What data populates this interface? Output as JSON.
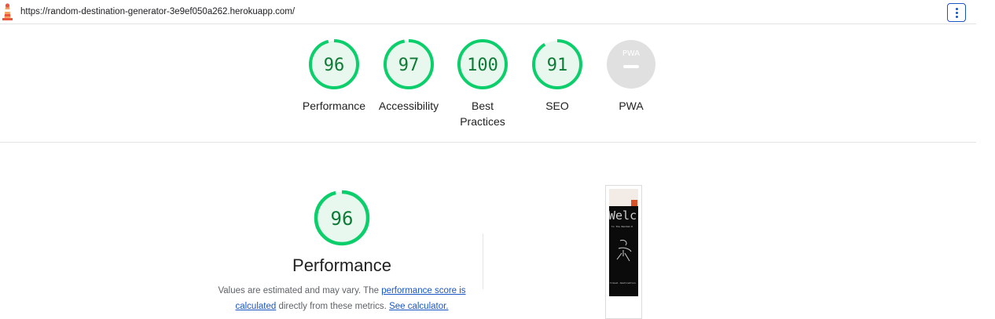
{
  "topbar": {
    "url": "https://random-destination-generator-3e9ef050a262.herokuapp.com/",
    "logo_icon": "lighthouse-icon",
    "menu_icon": "kebab-menu-icon"
  },
  "colors": {
    "pass_green": "#0cce6b",
    "pass_fill": "#e8f8ee",
    "pass_text": "#0d7a35",
    "na_gray": "#e0e0e0",
    "link_blue": "#1a56c4"
  },
  "scores": [
    {
      "label": "Performance",
      "value": "96",
      "fraction": 0.96
    },
    {
      "label": "Accessibility",
      "value": "97",
      "fraction": 0.97
    },
    {
      "label": "Best Practices",
      "value": "100",
      "fraction": 1.0
    },
    {
      "label": "SEO",
      "value": "91",
      "fraction": 0.91
    },
    {
      "label": "PWA",
      "value": "",
      "badge_text": "PWA"
    }
  ],
  "performance": {
    "score": "96",
    "fraction": 0.96,
    "title": "Performance",
    "desc_part1": "Values are estimated and may vary. The ",
    "desc_link1": "performance score is calculated",
    "desc_part2": " directly from these metrics. ",
    "desc_link2": "See calculator."
  },
  "thumbnail": {
    "heading_text": "Welc",
    "subtext": "to the Random D",
    "footer_text": "travel destination"
  }
}
